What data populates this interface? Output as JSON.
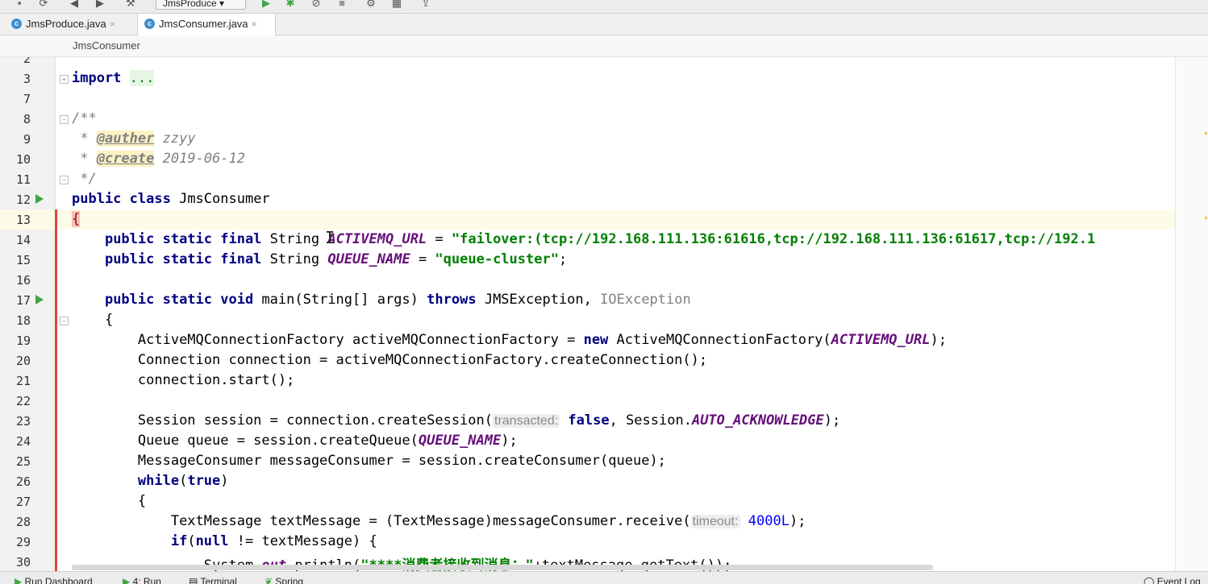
{
  "toolbar": {
    "run_config": "JmsProduce"
  },
  "tabs": [
    {
      "label": "JmsProduce.java",
      "icon": "java-class-icon"
    },
    {
      "label": "JmsConsumer.java",
      "icon": "java-class-icon"
    }
  ],
  "breadcrumb": "JmsConsumer",
  "lines": {
    "l2": "2",
    "l3": "3",
    "l7": "7",
    "l8": "8",
    "l9": "9",
    "l10": "10",
    "l11": "11",
    "l12": "12",
    "l13": "13",
    "l14": "14",
    "l15": "15",
    "l16": "16",
    "l17": "17",
    "l18": "18",
    "l19": "19",
    "l20": "20",
    "l21": "21",
    "l22": "22",
    "l23": "23",
    "l24": "24",
    "l25": "25",
    "l26": "26",
    "l27": "27",
    "l28": "28",
    "l29": "29",
    "l30": "30"
  },
  "code": {
    "import_kw": "import",
    "import_dots": "...",
    "doc_open": "/**",
    "doc_star": " * ",
    "auther_tag": "@auther",
    "auther_val": "zzyy",
    "create_tag": "@create",
    "create_val": "2019-06-12",
    "doc_close": " */",
    "public_class": "public class",
    "class_name": "JmsConsumer",
    "open_brace": "{",
    "psf": "public static final",
    "string_type": "String",
    "activemq_url_const": "ACTIVEMQ_URL",
    "eq": " = ",
    "url_value": "\"failover:(tcp://192.168.111.136:61616,tcp://192.168.111.136:61617,tcp://192.1",
    "queue_name_const": "QUEUE_NAME",
    "queue_value": "\"queue-cluster\"",
    "semi": ";",
    "psv": "public static void",
    "main_sig": "main(String[] args)",
    "throws_kw": "throws",
    "jms_ex": "JMSException,",
    "io_ex": "IOException",
    "l19_a": "ActiveMQConnectionFactory activeMQConnectionFactory = ",
    "new_kw": "new",
    "l19_b": "ActiveMQConnectionFactory(",
    "l19_c": ");",
    "l20": "Connection connection = activeMQConnectionFactory.createConnection();",
    "l21": "connection.start();",
    "l23_a": "Session session = connection.createSession(",
    "hint_transacted": "transacted:",
    "false_kw": "false",
    "l23_b": ", Session.",
    "auto_ack": "AUTO_ACKNOWLEDGE",
    "l23_c": ");",
    "l24_a": "Queue queue = session.createQueue(",
    "l24_c": ");",
    "l25": "MessageConsumer messageConsumer = session.createConsumer(queue);",
    "while_kw": "while",
    "true_kw": "true",
    "l28_a": "TextMessage textMessage = (TextMessage)messageConsumer.receive(",
    "hint_timeout": "timeout:",
    "timeout_val": "4000L",
    "l28_c": ");",
    "if_kw": "if",
    "null_kw": "null",
    "l29_b": " != textMessage) {",
    "l30_a": "System.",
    "out_field": "out",
    "l30_b": ".println(",
    "l30_str": "\"****消费者接收到消息：\"",
    "l30_c": "+textMessage.getText());"
  },
  "statusbar": {
    "run_dashboard": "Run Dashboard",
    "run": "4: Run",
    "terminal": "Terminal",
    "spring": "Spring",
    "event_log": "Event Log"
  }
}
